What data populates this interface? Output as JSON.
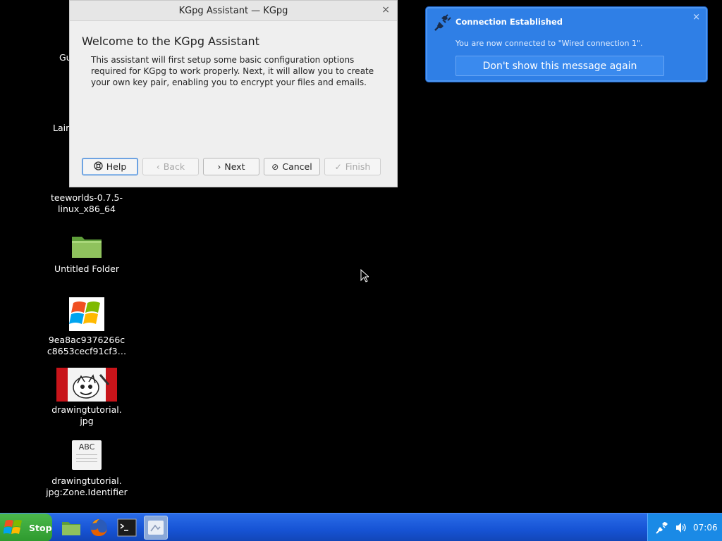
{
  "desktop": {
    "partial_labels": [
      "Gu",
      "Lair"
    ],
    "icons": [
      {
        "label_line1": "teeworlds-0.7.5-",
        "label_line2": "linux_x86_64",
        "icon": "binary-icon"
      },
      {
        "label_line1": "Untitled Folder",
        "label_line2": "",
        "icon": "folder-icon"
      },
      {
        "label_line1": "9ea8ac9376266c",
        "label_line2": "c8653cecf91cf3…",
        "icon": "windows-logo-icon"
      },
      {
        "label_line1": "drawingtutorial.",
        "label_line2": "jpg",
        "icon": "image-thumbnail-icon"
      },
      {
        "label_line1": "drawingtutorial.",
        "label_line2": "jpg:Zone.Identifier",
        "icon": "text-file-icon",
        "thumb_text": "ABC"
      }
    ]
  },
  "dialog": {
    "title": "KGpg Assistant — KGpg",
    "close": "×",
    "heading": "Welcome to the KGpg Assistant",
    "body": "This assistant will first setup some basic configuration options required for KGpg to work properly. Next, it will allow you to create your own key pair, enabling you to encrypt your files and emails.",
    "buttons": {
      "help": "Help",
      "back": "Back",
      "next": "Next",
      "cancel": "Cancel",
      "finish": "Finish"
    }
  },
  "notification": {
    "title": "Connection Established",
    "message": "You are now connected to \"Wired connection 1\".",
    "button": "Don't show this message again",
    "close": "×"
  },
  "taskbar": {
    "start_label": "Stop",
    "clock": "07:06",
    "quick_launch": [
      "file-manager-icon",
      "firefox-icon",
      "terminal-icon",
      "app-window-icon"
    ],
    "tray": [
      "network-icon",
      "volume-icon"
    ]
  }
}
